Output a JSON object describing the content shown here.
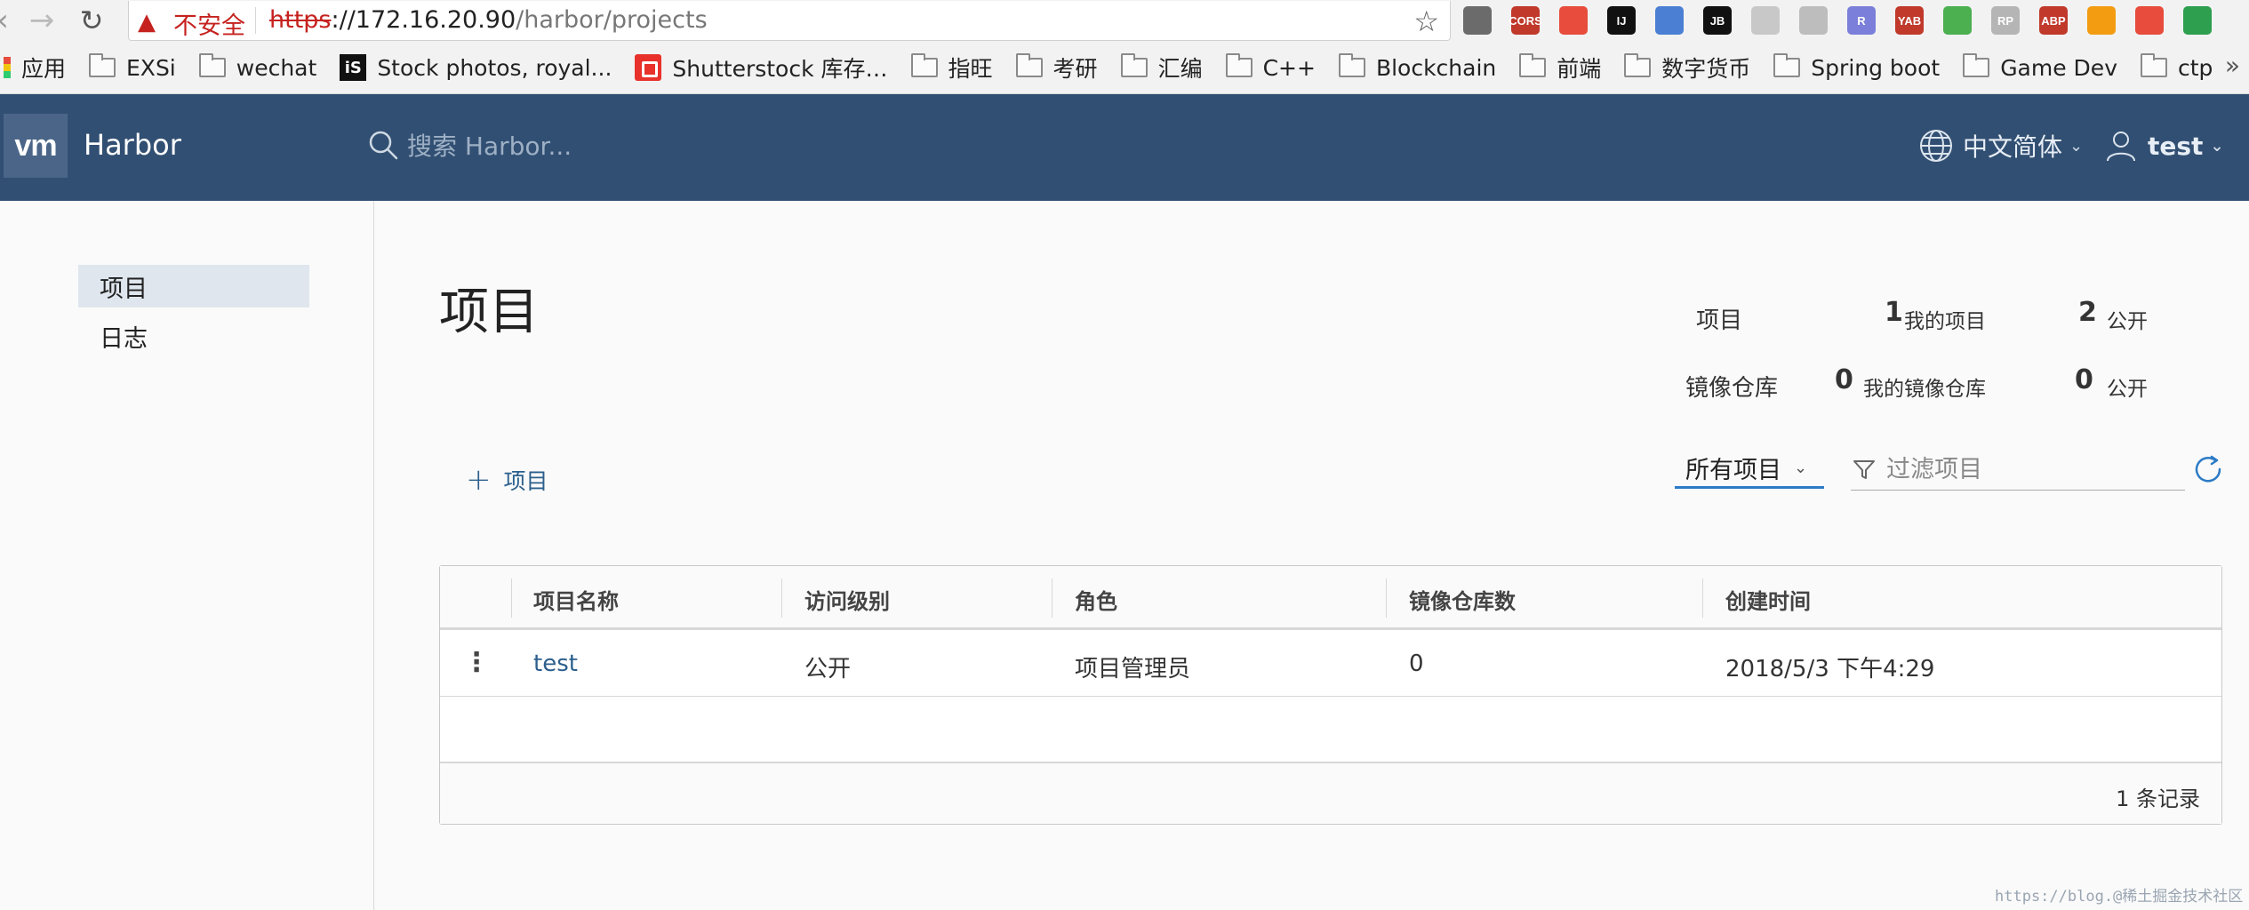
{
  "browser": {
    "security_label": "不安全",
    "url_protocol": "https",
    "url_host": "://172.16.20.90",
    "url_path": "/harbor/projects",
    "extensions": [
      {
        "name": "settings-ext-icon",
        "label": "",
        "color": "#6b6b6b"
      },
      {
        "name": "cors-ext-icon",
        "label": "CORS",
        "color": "#c0392b"
      },
      {
        "name": "trash-ext-icon",
        "label": "",
        "color": "#e74c3c"
      },
      {
        "name": "ij-ext-icon",
        "label": "IJ",
        "color": "#111111"
      },
      {
        "name": "code-ext-icon",
        "label": "",
        "color": "#4a7fd4"
      },
      {
        "name": "jb-ext-icon",
        "label": "JB",
        "color": "#111111"
      },
      {
        "name": "magnifier-ext-icon",
        "label": "",
        "color": "#c8c8c8"
      },
      {
        "name": "drop-ext-icon",
        "label": "",
        "color": "#bdbdbd"
      },
      {
        "name": "r-ext-icon",
        "label": "R",
        "color": "#7b7fd9"
      },
      {
        "name": "yab-ext-icon",
        "label": "YAB",
        "color": "#c0392b"
      },
      {
        "name": "shield-ext-icon",
        "label": "",
        "color": "#4caf50"
      },
      {
        "name": "rp-ext-icon",
        "label": "RP",
        "color": "#b5b5b5"
      },
      {
        "name": "abp-ext-icon",
        "label": "ABP",
        "color": "#c0392b"
      },
      {
        "name": "fox-ext-icon",
        "label": "",
        "color": "#f39c12"
      },
      {
        "name": "rocket-ext-icon",
        "label": "",
        "color": "#e74c3c"
      },
      {
        "name": "update-ext-icon",
        "label": "",
        "color": "#2e9e4f"
      }
    ]
  },
  "bookmarks": [
    {
      "name": "bookmark-apps",
      "label": "应用",
      "icon": "apps"
    },
    {
      "name": "bookmark-exsi",
      "label": "EXSi",
      "icon": "folder"
    },
    {
      "name": "bookmark-wechat",
      "label": "wechat",
      "icon": "folder"
    },
    {
      "name": "bookmark-stock-photos",
      "label": "Stock photos, royal...",
      "icon": "is"
    },
    {
      "name": "bookmark-shutterstock",
      "label": "Shutterstock 库存…",
      "icon": "ss"
    },
    {
      "name": "bookmark-zhiwang",
      "label": "指旺",
      "icon": "folder"
    },
    {
      "name": "bookmark-kaoyan",
      "label": "考研",
      "icon": "folder"
    },
    {
      "name": "bookmark-huibian",
      "label": "汇编",
      "icon": "folder"
    },
    {
      "name": "bookmark-cpp",
      "label": "C++",
      "icon": "folder"
    },
    {
      "name": "bookmark-blockchain",
      "label": "Blockchain",
      "icon": "folder"
    },
    {
      "name": "bookmark-qianduan",
      "label": "前端",
      "icon": "folder"
    },
    {
      "name": "bookmark-crypto",
      "label": "数字货币",
      "icon": "folder"
    },
    {
      "name": "bookmark-spring-boot",
      "label": "Spring boot",
      "icon": "folder"
    },
    {
      "name": "bookmark-game-dev",
      "label": "Game Dev",
      "icon": "folder"
    },
    {
      "name": "bookmark-ctp",
      "label": "ctp",
      "icon": "folder"
    }
  ],
  "header": {
    "logo_text": "vm",
    "app_name": "Harbor",
    "search_placeholder": "搜索 Harbor...",
    "language": "中文简体",
    "username": "test"
  },
  "sidebar": {
    "items": [
      {
        "label": "项目",
        "active": true
      },
      {
        "label": "日志",
        "active": false
      }
    ]
  },
  "main": {
    "title": "项目",
    "stats": {
      "projects_label": "项目",
      "my_projects_count": "1",
      "my_projects_label": "我的项目",
      "public_projects_count": "2",
      "public_projects_label": "公开",
      "repos_label": "镜像仓库",
      "my_repos_count": "0",
      "my_repos_label": "我的镜像仓库",
      "public_repos_count": "0",
      "public_repos_label": "公开"
    },
    "add_project_label": "项目",
    "filter_select": "所有项目",
    "filter_placeholder": "过滤项目",
    "table": {
      "columns": [
        "项目名称",
        "访问级别",
        "角色",
        "镜像仓库数",
        "创建时间"
      ],
      "rows": [
        {
          "name": "test",
          "access": "公开",
          "role": "项目管理员",
          "repo_count": "0",
          "created": "2018/5/3 下午4:29"
        }
      ],
      "footer_count": "1 条记录"
    }
  },
  "watermark": "https://blog.@稀土掘金技术社区"
}
